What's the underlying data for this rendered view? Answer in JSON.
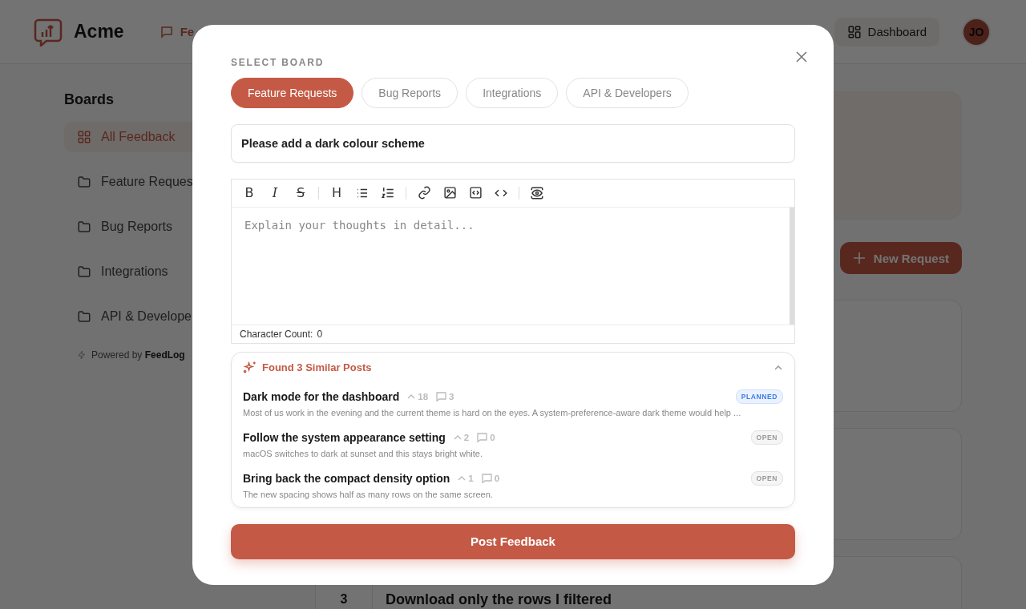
{
  "header": {
    "brand": "Acme",
    "nav": [
      {
        "label": "Fe",
        "selected": true
      }
    ],
    "dashboard": "Dashboard",
    "avatar": "JO"
  },
  "sidebar": {
    "title": "Boards",
    "items": [
      {
        "label": "All Feedback",
        "selected": true,
        "kind": "all"
      },
      {
        "label": "Feature Reques",
        "selected": false,
        "kind": "folder"
      },
      {
        "label": "Bug Reports",
        "selected": false,
        "kind": "folder"
      },
      {
        "label": "Integrations",
        "selected": false,
        "kind": "folder"
      },
      {
        "label": "API & Develope",
        "selected": false,
        "kind": "folder"
      }
    ],
    "footer_prefix": "Powered by",
    "footer_brand": "FeedLog"
  },
  "main": {
    "new_request": "New Request",
    "rows": [
      {
        "votes": "3",
        "title": "Download only the rows I filtered"
      }
    ]
  },
  "modal": {
    "label": "SELECT BOARD",
    "boards": [
      {
        "label": "Feature Requests",
        "selected": true
      },
      {
        "label": "Bug Reports",
        "selected": false
      },
      {
        "label": "Integrations",
        "selected": false
      },
      {
        "label": "API & Developers",
        "selected": false
      }
    ],
    "title_value": "Please add a dark colour scheme",
    "toolbar": [
      {
        "kind": "bold",
        "glyph": "B"
      },
      {
        "kind": "italic",
        "glyph": "I"
      },
      {
        "kind": "strike",
        "glyph": "S"
      },
      {
        "kind": "sep"
      },
      {
        "kind": "heading",
        "glyph": "H"
      },
      {
        "kind": "bullets"
      },
      {
        "kind": "numbers"
      },
      {
        "kind": "sep"
      },
      {
        "kind": "link"
      },
      {
        "kind": "image"
      },
      {
        "kind": "codeblock"
      },
      {
        "kind": "code"
      },
      {
        "kind": "sep"
      },
      {
        "kind": "preview"
      }
    ],
    "editor_placeholder": "Explain your thoughts in detail...",
    "char_label": "Character Count:",
    "char_value": "0",
    "similar": {
      "heading": "Found 3 Similar Posts",
      "expanded": true,
      "posts": [
        {
          "title": "Dark mode for the dashboard",
          "votes": "18",
          "comments": "3",
          "status": "PLANNED",
          "kind": "planned",
          "excerpt": "Most of us work in the evening and the current theme is hard on the eyes. A system-preference-aware dark theme would help ..."
        },
        {
          "title": "Follow the system appearance setting",
          "votes": "2",
          "comments": "0",
          "status": "OPEN",
          "kind": "open",
          "excerpt": "macOS switches to dark at sunset and this stays bright white."
        },
        {
          "title": "Bring back the compact density option",
          "votes": "1",
          "comments": "0",
          "status": "OPEN",
          "kind": "open",
          "excerpt": "The new spacing shows half as many rows on the same screen."
        }
      ]
    },
    "submit": "Post Feedback"
  }
}
